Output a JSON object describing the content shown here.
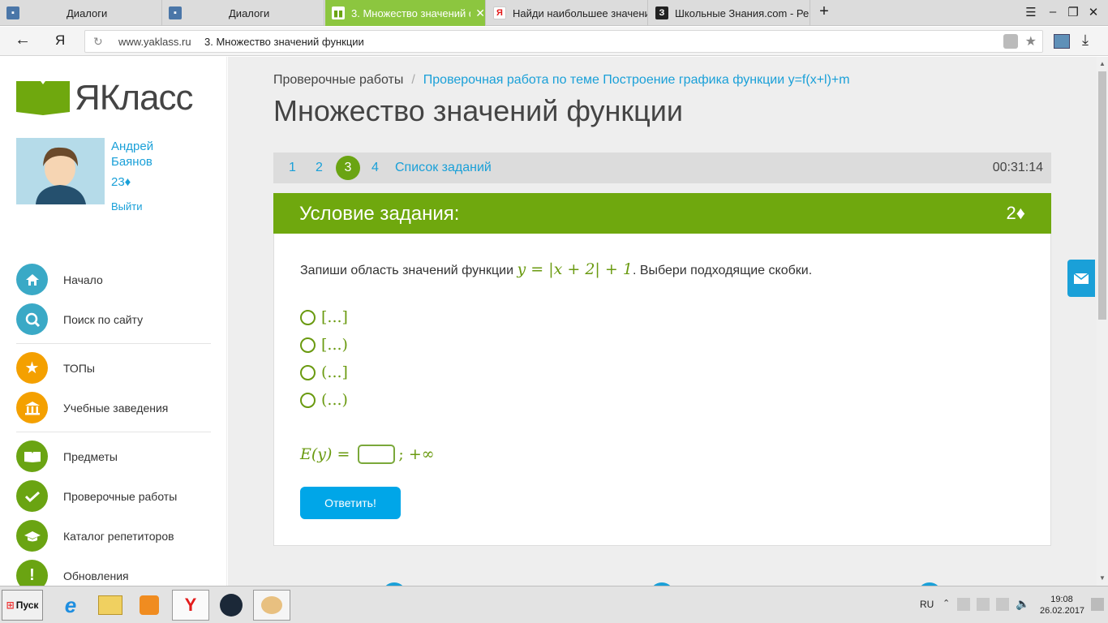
{
  "browser": {
    "tabs": [
      {
        "title": "Диалоги",
        "icon": "vk-icon"
      },
      {
        "title": "Диалоги",
        "icon": "vk-icon"
      },
      {
        "title": "3. Множество значений ф",
        "icon": "yaklass-icon",
        "active": true
      },
      {
        "title": "Найди наибольшее значени",
        "icon": "yandex-icon"
      },
      {
        "title": "Школьные Знания.com - Ре",
        "icon": "znanija-icon"
      }
    ],
    "new_tab": "+",
    "url_domain": "www.yaklass.ru",
    "url_title": "3. Множество значений функции",
    "yandex_letter": "Я"
  },
  "logo": {
    "text": "ЯКласс"
  },
  "user": {
    "first_name": "Андрей",
    "last_name": "Баянов",
    "points": "23♦",
    "logout": "Выйти"
  },
  "menu": [
    {
      "label": "Начало",
      "icon": "home-icon",
      "color": "#3aa9c6"
    },
    {
      "label": "Поиск по сайту",
      "icon": "search-icon",
      "color": "#3aa9c6"
    },
    {
      "label": "ТОПы",
      "icon": "star-icon",
      "color": "#f4a000"
    },
    {
      "label": "Учебные заведения",
      "icon": "institution-icon",
      "color": "#f4a000"
    },
    {
      "label": "Предметы",
      "icon": "book-icon",
      "color": "#6aa412"
    },
    {
      "label": "Проверочные работы",
      "icon": "check-icon",
      "color": "#6aa412"
    },
    {
      "label": "Каталог репетиторов",
      "icon": "graduation-cap-icon",
      "color": "#6aa412"
    },
    {
      "label": "Обновления",
      "icon": "exclamation-icon",
      "color": "#6aa412"
    }
  ],
  "breadcrumb": {
    "root": "Проверочные работы",
    "separator": "/",
    "current": "Проверочная работа по теме Построение графика функции y=f(x+l)+m"
  },
  "page_title": "Множество значений функции",
  "steps": {
    "items": [
      "1",
      "2",
      "3",
      "4"
    ],
    "current": "3",
    "list_link": "Список заданий",
    "timer": "00:31:14"
  },
  "task": {
    "header": "Условие задания:",
    "points": "2♦",
    "question_prefix": "Запиши область значений функции",
    "formula": "y = |x + 2| + 1",
    "question_suffix": ". Выбери подходящие скобки.",
    "options": [
      "[...]",
      "[...)",
      "(...]",
      "(...)"
    ],
    "answer_prefix": "E(y) =",
    "answer_suffix": "; +∞",
    "submit": "Ответить!"
  },
  "taskbar": {
    "start": "Пуск",
    "lang": "RU",
    "time": "19:08",
    "date": "26.02.2017"
  },
  "colors": {
    "accent": "#6fa80e",
    "link": "#1aa0d8",
    "button": "#00a6e8"
  }
}
